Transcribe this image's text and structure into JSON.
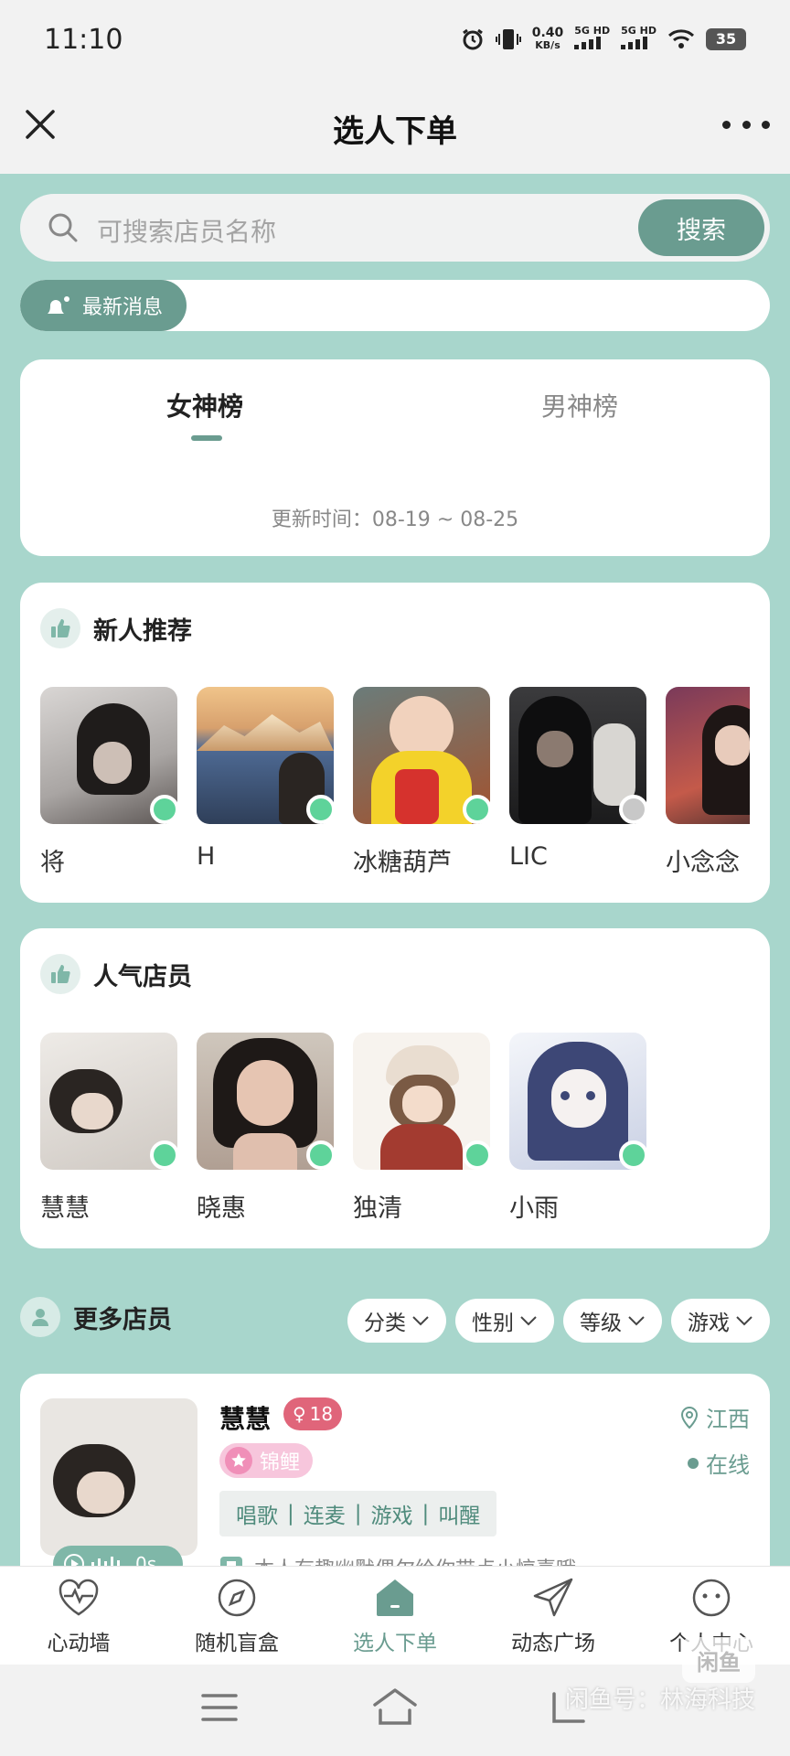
{
  "status_bar": {
    "time": "11:10",
    "net_speed_value": "0.40",
    "net_speed_unit": "KB/s",
    "signal_1": "5G HD",
    "signal_2": "5G HD",
    "battery": "35"
  },
  "nav": {
    "title": "选人下单"
  },
  "search": {
    "placeholder": "可搜索店员名称",
    "button_label": "搜索"
  },
  "notice": {
    "label": "最新消息"
  },
  "ranking": {
    "tabs": [
      {
        "label": "女神榜",
        "active": true
      },
      {
        "label": "男神榜",
        "active": false
      }
    ],
    "update_time": "更新时间：08-19 ~ 08-25"
  },
  "new_recommend": {
    "title": "新人推荐",
    "people": [
      {
        "name": "将",
        "online": true
      },
      {
        "name": "H",
        "online": true
      },
      {
        "name": "冰糖葫芦",
        "online": true
      },
      {
        "name": "LIC",
        "online": false
      },
      {
        "name": "小念念",
        "online": true
      }
    ]
  },
  "popular": {
    "title": "人气店员",
    "people": [
      {
        "name": "慧慧",
        "online": true
      },
      {
        "name": "晓惠",
        "online": true
      },
      {
        "name": "独清",
        "online": true
      },
      {
        "name": "小雨",
        "online": true
      }
    ]
  },
  "more": {
    "title": "更多店员",
    "filters": [
      "分类",
      "性别",
      "等级",
      "游戏"
    ]
  },
  "member": {
    "name": "慧慧",
    "gender_symbol": "♀",
    "age": "18",
    "level": "锦鲤",
    "tags": [
      "唱歌",
      "连麦",
      "游戏",
      "叫醒"
    ],
    "intro": "本人有趣幽默偶尔给你带点小惊喜哦~",
    "location": "江西",
    "status": "在线",
    "voice_duration": "0s"
  },
  "tab_bar": {
    "items": [
      {
        "label": "心动墙",
        "icon": "heart-pulse-icon",
        "active": false
      },
      {
        "label": "随机盲盒",
        "icon": "compass-icon",
        "active": false
      },
      {
        "label": "选人下单",
        "icon": "home-icon",
        "active": true
      },
      {
        "label": "动态广场",
        "icon": "paper-plane-icon",
        "active": false
      },
      {
        "label": "个人中心",
        "icon": "smile-icon",
        "active": false
      }
    ]
  },
  "watermark": {
    "logo_text": "闲鱼",
    "text": "闲鱼号：林海科技"
  },
  "colors": {
    "brand": "#6a9c90",
    "background": "#a8d6cc",
    "online": "#5ed39a"
  }
}
